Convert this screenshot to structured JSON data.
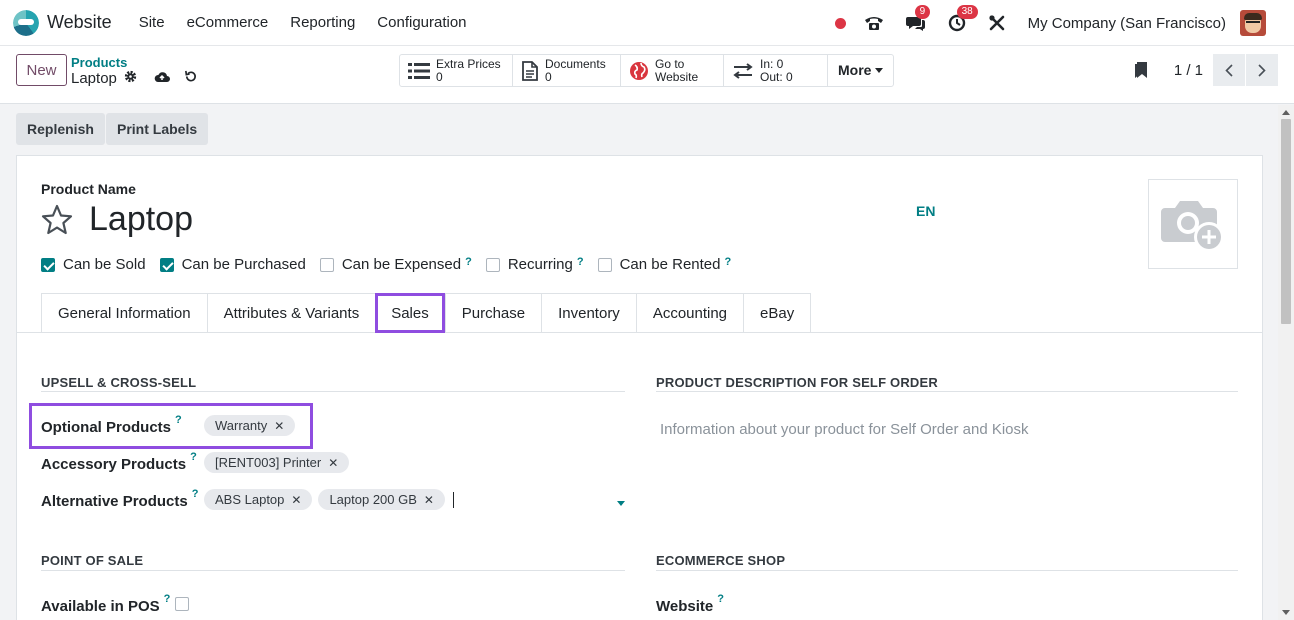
{
  "navbar": {
    "app_name": "Website",
    "menus": [
      "Site",
      "eCommerce",
      "Reporting",
      "Configuration"
    ],
    "messages_badge": "9",
    "activities_badge": "38",
    "company": "My Company (San Francisco)"
  },
  "control": {
    "new_label": "New",
    "breadcrumb_parent": "Products",
    "breadcrumb_current": "Laptop",
    "smart_buttons": [
      {
        "label": "Extra Prices",
        "value": "0"
      },
      {
        "label": "Documents",
        "value": "0"
      },
      {
        "label": "Go to",
        "value": "Website"
      },
      {
        "label": "In: 0",
        "value": "Out: 0"
      }
    ],
    "more_label": "More",
    "pager": "1 / 1"
  },
  "actions": {
    "replenish": "Replenish",
    "print_labels": "Print Labels"
  },
  "form": {
    "product_name_label": "Product Name",
    "product_name": "Laptop",
    "lang": "EN",
    "checkboxes": [
      {
        "label": "Can be Sold",
        "checked": true
      },
      {
        "label": "Can be Purchased",
        "checked": true
      },
      {
        "label": "Can be Expensed",
        "checked": false
      },
      {
        "label": "Recurring",
        "checked": false
      },
      {
        "label": "Can be Rented",
        "checked": false
      }
    ],
    "tabs": [
      "General Information",
      "Attributes & Variants",
      "Sales",
      "Purchase",
      "Inventory",
      "Accounting",
      "eBay"
    ],
    "active_tab": "Sales"
  },
  "sales": {
    "upsell_title": "UPSELL & CROSS-SELL",
    "optional_label": "Optional Products",
    "optional_tags": [
      "Warranty"
    ],
    "accessory_label": "Accessory Products",
    "accessory_tags": [
      "[RENT003] Printer"
    ],
    "alternative_label": "Alternative Products",
    "alternative_tags": [
      "ABS Laptop",
      "Laptop 200 GB"
    ],
    "self_order_title": "PRODUCT DESCRIPTION FOR SELF ORDER",
    "self_order_placeholder": "Information about your product for Self Order and Kiosk",
    "pos_title": "POINT OF SALE",
    "pos_available_label": "Available in POS",
    "ecommerce_title": "ECOMMERCE SHOP",
    "website_label": "Website"
  },
  "help_mark": "?",
  "colors": {
    "accent": "#714b67",
    "teal": "#017e84",
    "highlight": "#8f4de0"
  }
}
